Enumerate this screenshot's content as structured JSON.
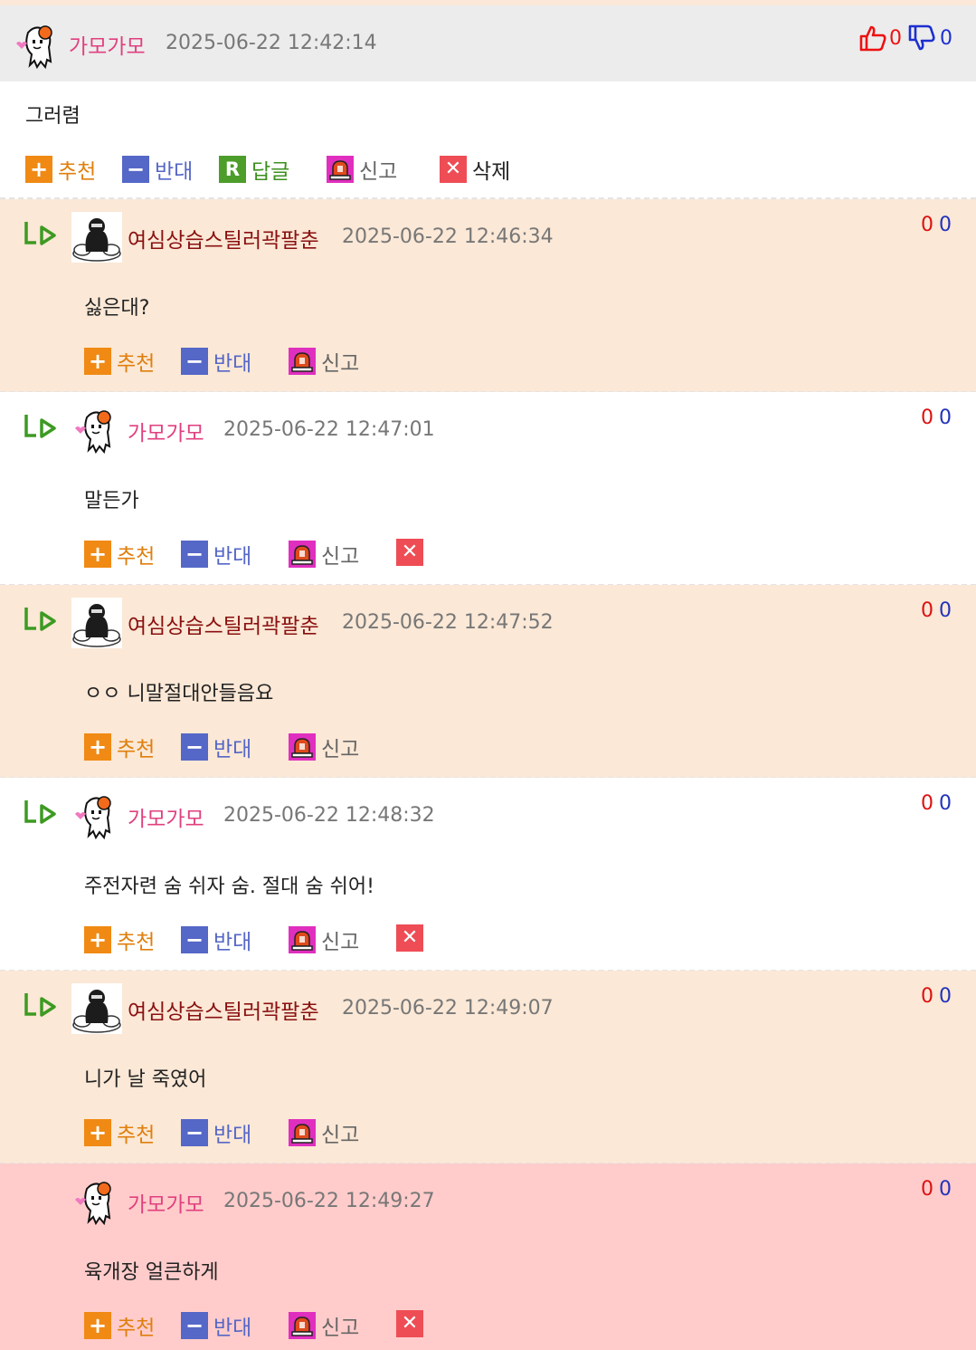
{
  "main": {
    "nickname": "가모가모",
    "date": "2025-06-22 12:42:14",
    "content": "그러렴",
    "up_count": "0",
    "down_count": "0",
    "actions": {
      "recommend": "추천",
      "oppose": "반대",
      "reply": "답글",
      "report": "신고",
      "delete": "삭제"
    }
  },
  "reply_actions": {
    "recommend": "추천",
    "oppose": "반대",
    "report": "신고"
  },
  "replies": [
    {
      "nickname": "여심상습스틸러곽팔춘",
      "date": "2025-06-22 12:46:34",
      "content": "싫은대?",
      "up": "0",
      "down": "0"
    },
    {
      "nickname": "가모가모",
      "date": "2025-06-22 12:47:01",
      "content": "말든가",
      "up": "0",
      "down": "0"
    },
    {
      "nickname": "여심상습스틸러곽팔춘",
      "date": "2025-06-22 12:47:52",
      "content": "ㅇㅇ 니말절대안들음요",
      "up": "0",
      "down": "0"
    },
    {
      "nickname": "가모가모",
      "date": "2025-06-22 12:48:32",
      "content": "주전자련 숨 쉬자 숨. 절대 숨 쉬어!",
      "up": "0",
      "down": "0"
    },
    {
      "nickname": "여심상습스틸러곽팔춘",
      "date": "2025-06-22 12:49:07",
      "content": "니가 날 죽였어",
      "up": "0",
      "down": "0"
    },
    {
      "nickname": "가모가모",
      "date": "2025-06-22 12:49:27",
      "content": "육개장 얼큰하게",
      "up": "0",
      "down": "0"
    }
  ],
  "colors": {
    "peach_bg": "#fbe8d6",
    "highlight_bg": "#ffcccb",
    "header_bg": "#ececec",
    "pink_nick": "#e0407f",
    "red_nick": "#8a1010"
  }
}
